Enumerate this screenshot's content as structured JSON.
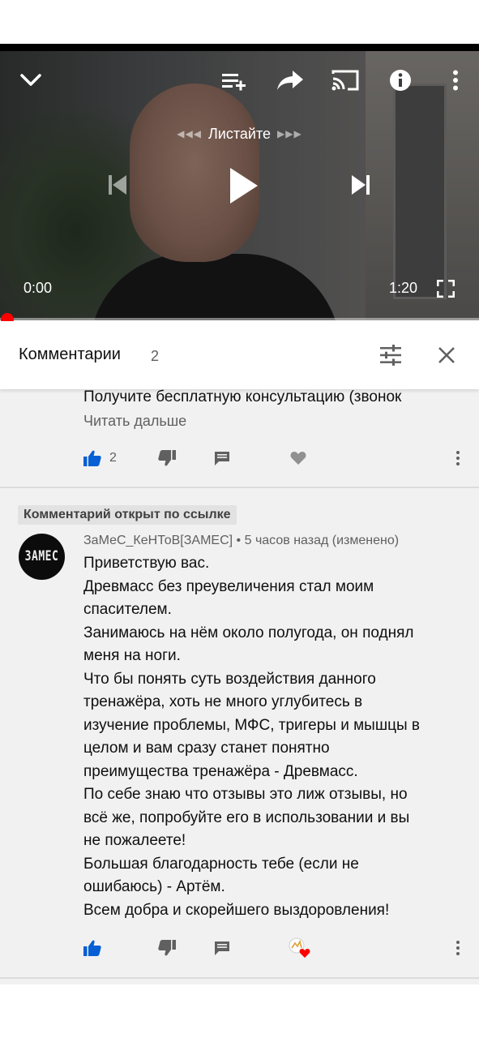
{
  "player": {
    "swipe_label": "Листайте",
    "swipe_left_arrows": "◀◀◀",
    "swipe_right_arrows": "▶▶▶",
    "current_time": "0:00",
    "duration": "1:20",
    "progress_fraction": 0.0
  },
  "comments_panel": {
    "title": "Комментарии",
    "count": "2"
  },
  "first_comment": {
    "text_tail": "Получите  бесплатную консультацию (звонок",
    "read_more": "Читать дальше",
    "like_count": "2"
  },
  "linked_comment": {
    "badge": "Комментарий открыт по ссылке",
    "avatar_text": "ЗАМЕС",
    "author": "ЗаМеС_КеНТоВ[ЗАМЕС]",
    "separator": "•",
    "time": "5 часов назад (изменено)",
    "lines": [
      "Приветствую вас.",
      "Древмасс без преувеличения стал моим",
      "спасителем.",
      "Занимаюсь на нём около полугода, он поднял",
      "меня на ноги.",
      "Что бы понять суть воздействия данного",
      "тренажёра, хоть не много углубитесь в",
      "изучение проблемы, МФС, тригеры и мышцы в",
      "целом и вам сразу станет понятно",
      "преимущества тренажёра - Древмасс.",
      "По себе знаю что отзывы это лиж отзывы, но",
      "всё же, попробуйте его в использовании и вы",
      "не пожалеете!",
      "Большая благодарность тебе (если не",
      "ошибаюсь) - Артём.",
      "Всем добра и скорейшего выздоровления!"
    ]
  },
  "colors": {
    "accent_red": "#ff0000",
    "like_blue": "#065fd4",
    "list_background": "#f1f1f1"
  },
  "icons": [
    "chevron-down-icon",
    "add-to-queue-icon",
    "share-icon",
    "cast-icon",
    "info-icon",
    "more-vert-icon",
    "previous-icon",
    "play-icon",
    "next-icon",
    "fullscreen-icon",
    "filter-icon",
    "close-icon",
    "thumb-up-icon",
    "thumb-down-icon",
    "reply-icon",
    "heart-icon",
    "creator-heart-icon"
  ]
}
